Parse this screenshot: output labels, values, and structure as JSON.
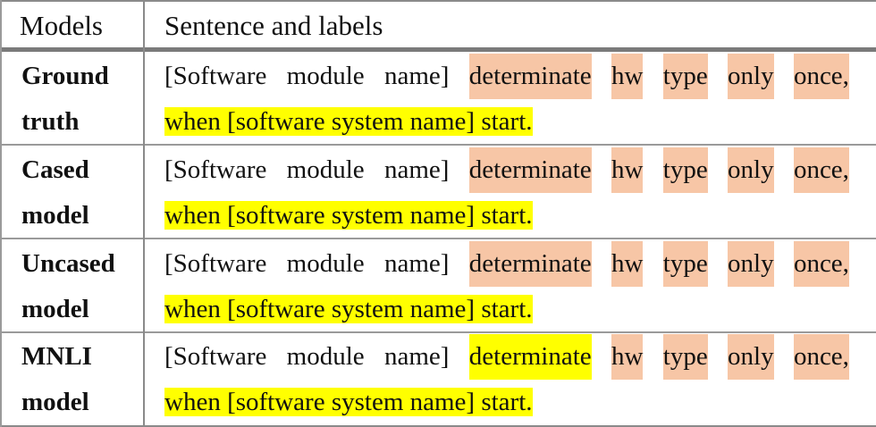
{
  "header": {
    "models": "Models",
    "sentence": "Sentence and labels"
  },
  "rows": [
    {
      "model": [
        "Ground",
        "truth"
      ],
      "line1": [
        "[Software",
        "module",
        "name]"
      ],
      "line1_hl": [
        "determinate",
        "hw",
        "type",
        "only",
        "once,"
      ],
      "line2": "when [software system name] start."
    },
    {
      "model": [
        "Cased",
        "model"
      ],
      "line1": [
        "[Software",
        "module",
        "name]"
      ],
      "line1_hl": [
        "determinate",
        "hw",
        "type",
        "only",
        "once,"
      ],
      "line2": "when [software system name] start."
    },
    {
      "model": [
        "Uncased",
        "model"
      ],
      "line1": [
        "[Software",
        "module",
        "name]"
      ],
      "line1_hl": [
        "determinate",
        "hw",
        "type",
        "only",
        "once,"
      ],
      "line2": "when [software system name] start."
    },
    {
      "model": [
        "MNLI",
        "model"
      ],
      "line1": [
        "[Software",
        "module",
        "name]"
      ],
      "line1_yl": "determinate",
      "line1_hl": [
        "hw",
        "type",
        "only",
        "once,"
      ],
      "line2": "when [software system name] start."
    }
  ],
  "colors": {
    "orange_highlight": "#f7c6a6",
    "yellow_highlight": "#ffff00",
    "rule": "#8a8a8a"
  }
}
